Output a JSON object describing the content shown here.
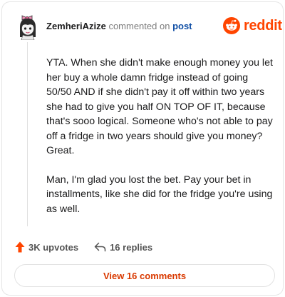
{
  "header": {
    "username": "ZemheriAzize",
    "action_text": "commented on",
    "post_link": "post"
  },
  "brand": {
    "wordmark": "reddit",
    "color": "#ff4500"
  },
  "comment": {
    "paragraphs": [
      "YTA. When she didn't make enough money you let her buy a whole damn fridge instead of going 50/50 AND if she didn't pay it off within two years she had to give you half ON TOP OF IT, because that's sooo logical. Someone who's not able to pay off a fridge in two years should give you money? Great.",
      "Man, I'm glad you lost the bet. Pay your bet in installments, like she did for the fridge you're using as well."
    ]
  },
  "actions": {
    "upvotes": "3K upvotes",
    "upvote_icon": "arrow-up-icon",
    "replies": "16 replies",
    "reply_icon": "reply-arrow-icon"
  },
  "footer": {
    "view_comments": "View 16 comments"
  },
  "colors": {
    "accent": "#ff4500",
    "link": "#0f4ea5",
    "button_text": "#d93900"
  }
}
